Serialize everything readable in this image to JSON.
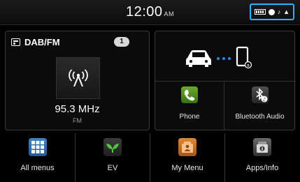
{
  "status": {
    "time": "12:00",
    "ampm": "AM",
    "icons": [
      "battery-icon",
      "bluetooth-icon",
      "music-note-icon",
      "signal-icon"
    ],
    "accent_color": "#28b4ff"
  },
  "radio": {
    "title": "DAB/FM",
    "preset": "1",
    "frequency": "95.3 MHz",
    "band": "FM"
  },
  "connection": {
    "phone_label": "Phone",
    "bluetooth_label": "Bluetooth Audio"
  },
  "bottom": {
    "all_menus": "All menus",
    "ev": "EV",
    "my_menu": "My Menu",
    "apps_info": "Apps/Info"
  }
}
